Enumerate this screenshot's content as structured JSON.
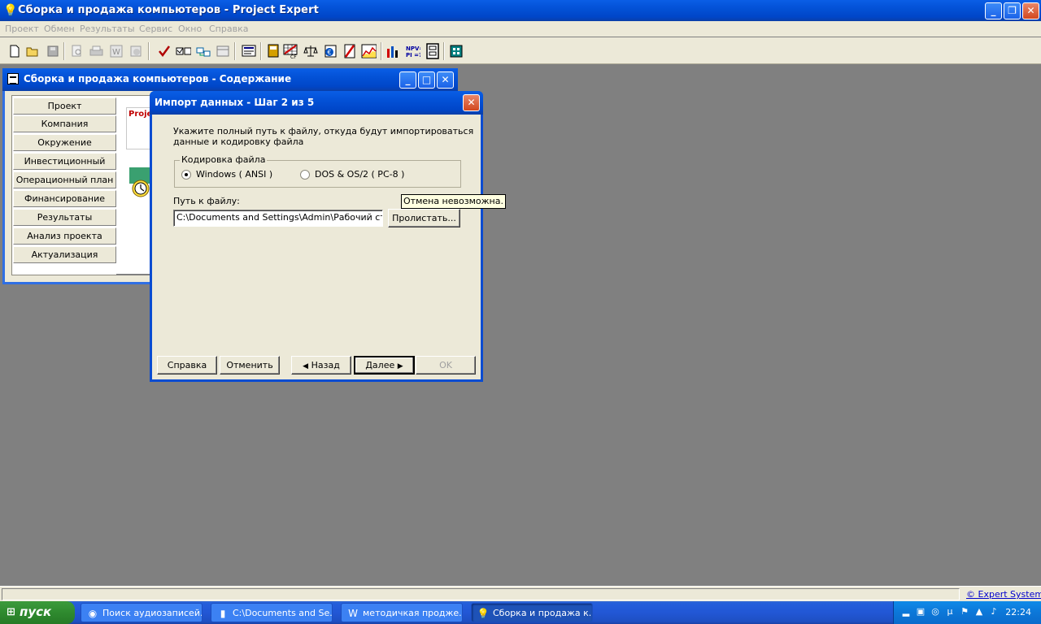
{
  "app": {
    "title": "Сборка и продажа компьютеров - Project Expert",
    "menu": [
      "Проект",
      "Обмен",
      "Результаты",
      "Сервис",
      "Окно",
      "Справка"
    ]
  },
  "contents_window": {
    "title": "Сборка и продажа компьютеров - Содержание",
    "nav": [
      "Проект",
      "Компания",
      "Окружение",
      "Инвестиционный план",
      "Операционный план",
      "Финансирование",
      "Результаты",
      "Анализ проекта",
      "Актуализация"
    ],
    "logo_text": "Projec"
  },
  "dialog": {
    "title": "Импорт данных - Шаг 2 из 5",
    "instruction_line1": "Укажите полный путь к файлу, откуда будут импортироваться",
    "instruction_line2": "данные и кодировку файла",
    "encoding_group": "Кодировка файла",
    "encoding_options": [
      "Windows ( ANSI )",
      "DOS & OS/2 ( PC-8 )"
    ],
    "selected_encoding": "Windows ( ANSI )",
    "path_label": "Путь к файлу:",
    "path_value": "C:\\Documents and Settings\\Admin\\Рабочий стол\\м",
    "browse_button": "Пролистать...",
    "buttons": {
      "help": "Справка",
      "cancel": "Отменить",
      "back": "Назад",
      "next": "Далее",
      "ok": "OK"
    },
    "tooltip": "Отмена невозможна."
  },
  "statusbar": {
    "copyright": "© Expert Systems"
  },
  "taskbar": {
    "start_label": "пуск",
    "tasks": [
      "Поиск аудиозаписей...",
      "C:\\Documents and Se...",
      "методичкая продже...",
      "Сборка и продажа к..."
    ],
    "active_task_index": 3,
    "clock": "22:24"
  },
  "colors": {
    "xp_blue": "#0351d6",
    "window_face": "#ece9d8",
    "desktop": "#808080",
    "tooltip_bg": "#ffffe1",
    "start_green": "#2f8a2f"
  }
}
